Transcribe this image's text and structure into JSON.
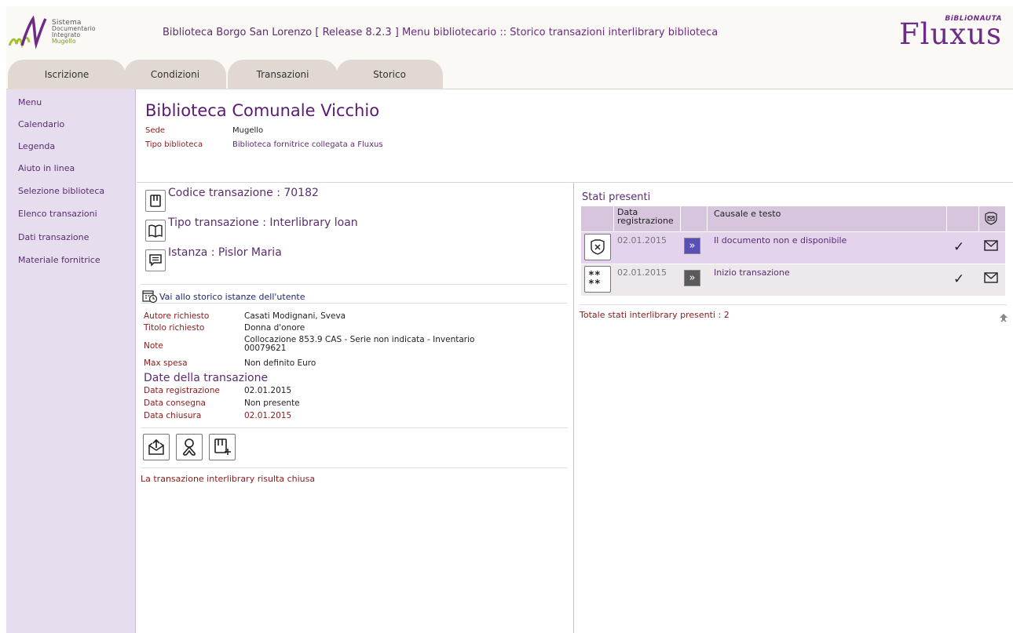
{
  "header": {
    "logo_lines": [
      "Sistema",
      "Documentario",
      "Integrato",
      "Mugello"
    ],
    "title_prefix": "Biblioteca Borgo San Lorenzo [ Release 8.2.3 ]",
    "title_suffix": "Menu bibliotecario :: Storico transazioni interlibrary biblioteca",
    "brand_badge": "BiBLiONAUTA",
    "brand_name": "Fluxus"
  },
  "tabs": [
    "Iscrizione",
    "Condizioni",
    "Transazioni",
    "Storico"
  ],
  "sidebar": {
    "items": [
      "Menu",
      "Calendario",
      "Legenda",
      "Aiuto in linea",
      "Selezione biblioteca",
      "Elenco transazioni",
      "Dati transazione",
      "Materiale fornitrice"
    ]
  },
  "library": {
    "name": "Biblioteca Comunale Vicchio",
    "sede_label": "Sede",
    "sede_value": "Mugello",
    "tipo_label": "Tipo biblioteca",
    "tipo_value": "Biblioteca fornitrice collegata a Fluxus"
  },
  "transaction": {
    "codice": "Codice transazione : 70182",
    "tipo": "Tipo transazione : Interlibrary loan",
    "istanza": "Istanza : Pislor Maria",
    "storico_link": "Vai allo storico istanze dell'utente",
    "details": [
      {
        "label": "Autore richiesto",
        "value": "Casati Modignani, Sveva"
      },
      {
        "label": "Titolo richiesto",
        "value": "Donna d'onore"
      },
      {
        "label": "Note",
        "value_line1": "Collocazione 853.9 CAS - Serie non indicata - Inventario",
        "value_line2": "00079621"
      },
      {
        "label": "Max spesa",
        "value": "Non definito Euro"
      }
    ],
    "dates_title": "Date della transazione",
    "dates": [
      {
        "label": "Data registrazione",
        "value": "02.01.2015"
      },
      {
        "label": "Data consegna",
        "value": "Non presente"
      },
      {
        "label": "Data chiusura",
        "value": "02.01.2015"
      }
    ],
    "closed_message": "La transazione interlibrary risulta chiusa"
  },
  "stati": {
    "title": "Stati presenti",
    "col_date_line1": "Data",
    "col_date_line2": "registrazione",
    "col_text": "Causale e testo",
    "rows": [
      {
        "date": "02.01.2015",
        "text": "Il documento non e disponibile"
      },
      {
        "date": "02.01.2015",
        "text": "Inizio transazione"
      }
    ],
    "totale": "Totale stati interlibrary presenti : 2"
  },
  "colors": {
    "primary": "#5a2d6e",
    "label_red": "#8a1a1a",
    "sidebar_bg": "#e6deef",
    "tab_bg": "#e2d8d3",
    "header_bg": "#fbf9f6"
  }
}
